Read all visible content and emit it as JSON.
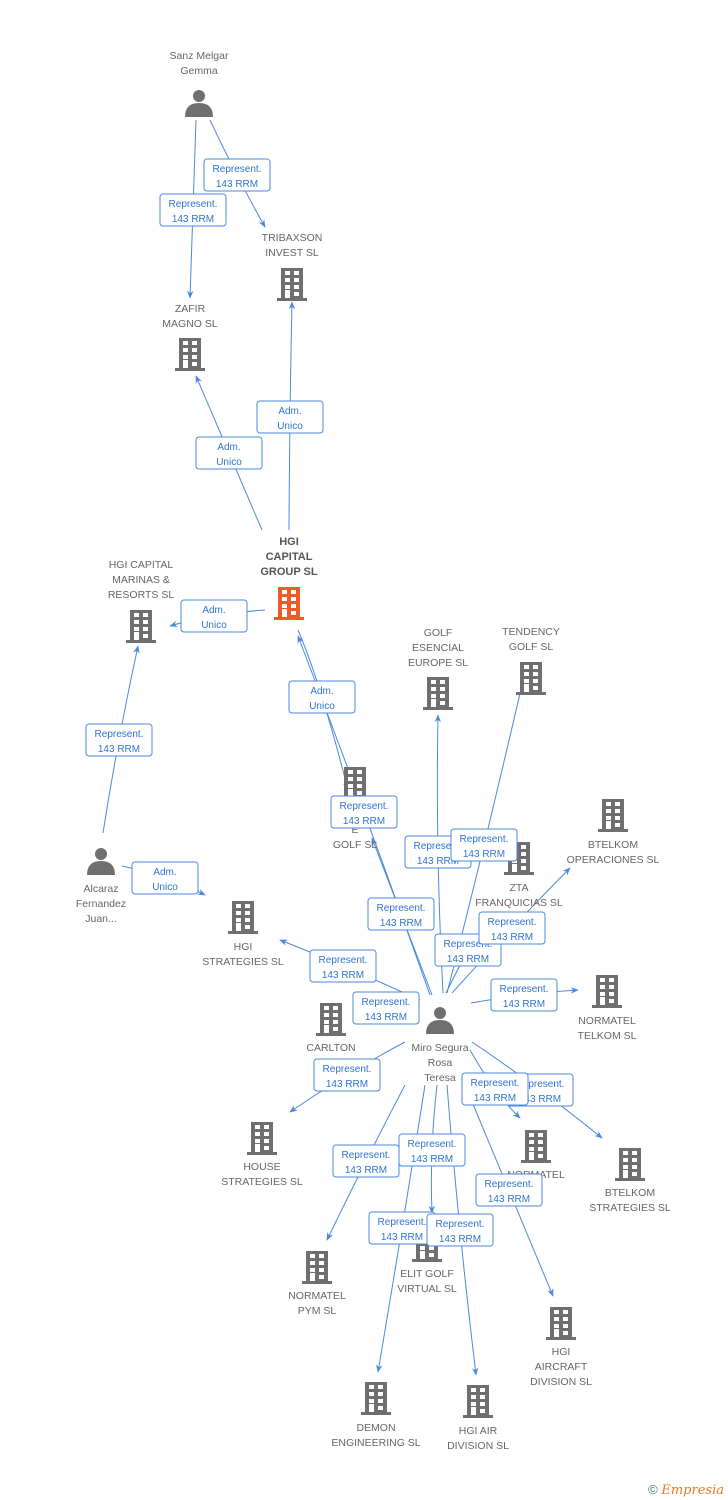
{
  "colors": {
    "edge": "#4a89dc",
    "node": "#6f6f6f",
    "main_node": "#f05a28"
  },
  "nodes": [
    {
      "id": "sanz",
      "type": "person",
      "label": [
        "Sanz Melgar",
        "Gemma"
      ]
    },
    {
      "id": "tribaxson",
      "type": "company",
      "label": [
        "TRIBAXSON",
        "INVEST SL"
      ]
    },
    {
      "id": "zafir",
      "type": "company",
      "label": [
        "ZAFIR",
        "MAGNO SL"
      ]
    },
    {
      "id": "hgi",
      "type": "main",
      "label": [
        "HGI",
        "CAPITAL",
        "GROUP SL"
      ]
    },
    {
      "id": "marinas",
      "type": "company",
      "label": [
        "HGI CAPITAL",
        "MARINAS &",
        "RESORTS SL"
      ]
    },
    {
      "id": "alcaraz",
      "type": "person",
      "label": [
        "Alcaraz",
        "Fernandez",
        "Juan..."
      ]
    },
    {
      "id": "hgistrat",
      "type": "company",
      "label": [
        "HGI",
        "STRATEGIES SL"
      ]
    },
    {
      "id": "golfesencial",
      "type": "company",
      "label": [
        "GOLF",
        "ESENCIAL",
        "EUROPE  SL"
      ]
    },
    {
      "id": "tendency",
      "type": "company",
      "label": [
        "TENDENCY",
        "GOLF  SL"
      ]
    },
    {
      "id": "egolf",
      "type": "company",
      "label": [
        "E",
        "GOLF  SL"
      ]
    },
    {
      "id": "btelkomop",
      "type": "company",
      "label": [
        "BTELKOM",
        "OPERACIONES SL"
      ]
    },
    {
      "id": "zta",
      "type": "company",
      "label": [
        "ZTA",
        "FRANQUICIAS SL"
      ]
    },
    {
      "id": "normateltelkom",
      "type": "company",
      "label": [
        "NORMATEL",
        "TELKOM SL"
      ]
    },
    {
      "id": "miro",
      "type": "person",
      "label": [
        "Miro Segura",
        "Rosa",
        "Teresa"
      ]
    },
    {
      "id": "carlton",
      "type": "company",
      "label": [
        "CARLTON",
        "INTER",
        "SL"
      ]
    },
    {
      "id": "house",
      "type": "company",
      "label": [
        "HOUSE",
        "STRATEGIES SL"
      ]
    },
    {
      "id": "normatelx",
      "type": "company",
      "label": [
        "NORMATEL",
        "SL"
      ]
    },
    {
      "id": "btelkomstrat",
      "type": "company",
      "label": [
        "BTELKOM",
        "STRATEGIES SL"
      ]
    },
    {
      "id": "normatelpym",
      "type": "company",
      "label": [
        "NORMATEL",
        "PYM SL"
      ]
    },
    {
      "id": "elitgolf",
      "type": "company",
      "label": [
        "ELIT GOLF",
        "VIRTUAL  SL"
      ]
    },
    {
      "id": "aircraft",
      "type": "company",
      "label": [
        "HGI",
        "AIRCRAFT",
        "DIVISION SL"
      ]
    },
    {
      "id": "demon",
      "type": "company",
      "label": [
        "DEMON",
        "ENGINEERING SL"
      ]
    },
    {
      "id": "hgiair",
      "type": "company",
      "label": [
        "HGI AIR",
        "DIVISION SL"
      ]
    }
  ],
  "edges": [
    {
      "from": "sanz",
      "to": "tribaxson",
      "label": [
        "Represent.",
        "143 RRM"
      ]
    },
    {
      "from": "sanz",
      "to": "zafir",
      "label": [
        "Represent.",
        "143 RRM"
      ]
    },
    {
      "from": "hgi",
      "to": "tribaxson",
      "label": [
        "Adm.",
        "Unico"
      ]
    },
    {
      "from": "hgi",
      "to": "zafir",
      "label": [
        "Adm.",
        "Unico"
      ]
    },
    {
      "from": "hgi",
      "to": "marinas",
      "label": [
        "Adm.",
        "Unico"
      ]
    },
    {
      "from": "hgi",
      "to": "egolf",
      "label": [
        "Adm.",
        "Unico"
      ]
    },
    {
      "from": "alcaraz",
      "to": "marinas",
      "label": [
        "Represent.",
        "143 RRM"
      ]
    },
    {
      "from": "alcaraz",
      "to": "hgistrat",
      "label": [
        "Adm.",
        "Unico"
      ]
    },
    {
      "from": "miro",
      "to": "hgi",
      "label": [
        "Represent.",
        "143 RRM"
      ]
    },
    {
      "from": "miro",
      "to": "egolf",
      "label": [
        "Represent.",
        "143 RRM"
      ]
    },
    {
      "from": "miro",
      "to": "golfesencial",
      "label": [
        "Represent.",
        "143 RRM"
      ]
    },
    {
      "from": "miro",
      "to": "tendency",
      "label": [
        "Represent.",
        "143 RRM"
      ]
    },
    {
      "from": "miro",
      "to": "zta",
      "label": [
        "Represent.",
        "143 RRM"
      ]
    },
    {
      "from": "miro",
      "to": "btelkomop",
      "label": [
        "Represent.",
        "143 RRM"
      ]
    },
    {
      "from": "miro",
      "to": "hgistrat",
      "label": [
        "Represent.",
        "143 RRM"
      ]
    },
    {
      "from": "miro",
      "to": "carlton",
      "label": [
        "Represent.",
        "143 RRM"
      ]
    },
    {
      "from": "miro",
      "to": "normateltelkom",
      "label": [
        "Represent.",
        "143 RRM"
      ]
    },
    {
      "from": "miro",
      "to": "house",
      "label": [
        "Represent.",
        "143 RRM"
      ]
    },
    {
      "from": "miro",
      "to": "btelkomstrat",
      "label": [
        "Represent.",
        "143 RRM"
      ]
    },
    {
      "from": "miro",
      "to": "normatelx",
      "label": [
        "Represent.",
        "143 RRM"
      ]
    },
    {
      "from": "miro",
      "to": "normatelpym",
      "label": [
        "Represent.",
        "143 RRM"
      ]
    },
    {
      "from": "miro",
      "to": "elitgolf",
      "label": [
        "Represent.",
        "143 RRM"
      ]
    },
    {
      "from": "miro",
      "to": "aircraft",
      "label": [
        "Represent.",
        "143 RRM"
      ]
    },
    {
      "from": "miro",
      "to": "demon",
      "label": [
        "Represent.",
        "143 RRM"
      ]
    },
    {
      "from": "miro",
      "to": "hgiair",
      "label": [
        "Represent.",
        "143 RRM"
      ]
    }
  ],
  "watermark": {
    "copyright": "©",
    "brand": "Empresia"
  }
}
